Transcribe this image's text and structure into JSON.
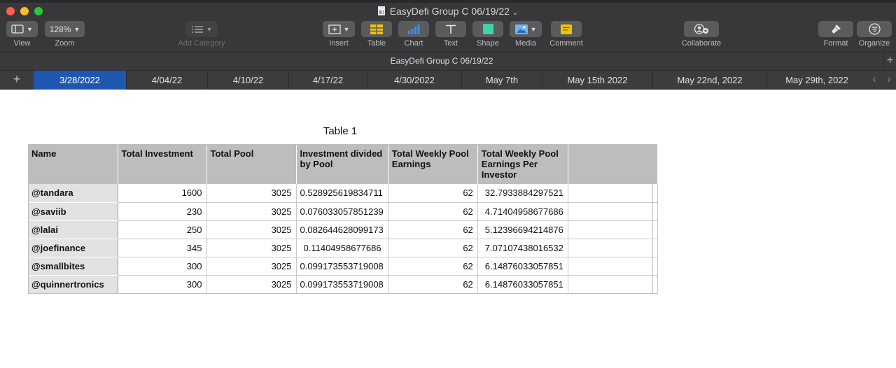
{
  "window": {
    "title": "EasyDefi Group C 06/19/22"
  },
  "toolbar": {
    "view_label": "View",
    "zoom_value": "128%",
    "zoom_label": "Zoom",
    "add_category_label": "Add Category",
    "insert_label": "Insert",
    "table_label": "Table",
    "chart_label": "Chart",
    "text_label": "Text",
    "shape_label": "Shape",
    "media_label": "Media",
    "comment_label": "Comment",
    "collaborate_label": "Collaborate",
    "format_label": "Format",
    "organize_label": "Organize"
  },
  "sheet_name": "EasyDefi Group C 06/19/22",
  "tabs": [
    {
      "label": "3/28/2022",
      "active": true
    },
    {
      "label": "4/04/22"
    },
    {
      "label": "4/10/22"
    },
    {
      "label": "4/17/22"
    },
    {
      "label": "4/30/2022"
    },
    {
      "label": "May 7th"
    },
    {
      "label": "May 15th 2022"
    },
    {
      "label": "May 22nd, 2022"
    },
    {
      "label": "May 29th, 2022"
    }
  ],
  "table": {
    "title": "Table 1",
    "headers": [
      "Name",
      "Total Investment",
      "Total Pool",
      "Investment divided by Pool",
      "Total Weekly Pool Earnings",
      "Total Weekly Pool Earnings Per Investor",
      ""
    ],
    "rows": [
      [
        "@tandara",
        "1600",
        "3025",
        "0.528925619834711",
        "62",
        "32.7933884297521"
      ],
      [
        "@saviib",
        "230",
        "3025",
        "0.076033057851239",
        "62",
        "4.71404958677686"
      ],
      [
        "@lalai",
        "250",
        "3025",
        "0.082644628099173",
        "62",
        "5.12396694214876"
      ],
      [
        "@joefinance",
        "345",
        "3025",
        "0.11404958677686",
        "62",
        "7.07107438016532"
      ],
      [
        "@smallbites",
        "300",
        "3025",
        "0.099173553719008",
        "62",
        "6.14876033057851"
      ],
      [
        "@quinnertronics",
        "300",
        "3025",
        "0.099173553719008",
        "62",
        "6.14876033057851"
      ]
    ]
  },
  "icons": {
    "view": "sidebar-view-icon",
    "add_category": "list-icon",
    "insert": "insert-plus-icon",
    "table": "table-grid-icon",
    "chart": "bar-chart-icon",
    "text": "text-t-icon",
    "shape": "shape-square-icon",
    "media": "media-image-icon",
    "comment": "comment-note-icon",
    "collaborate": "collaborate-person-icon",
    "format": "format-brush-icon",
    "organize": "organize-filter-icon"
  }
}
